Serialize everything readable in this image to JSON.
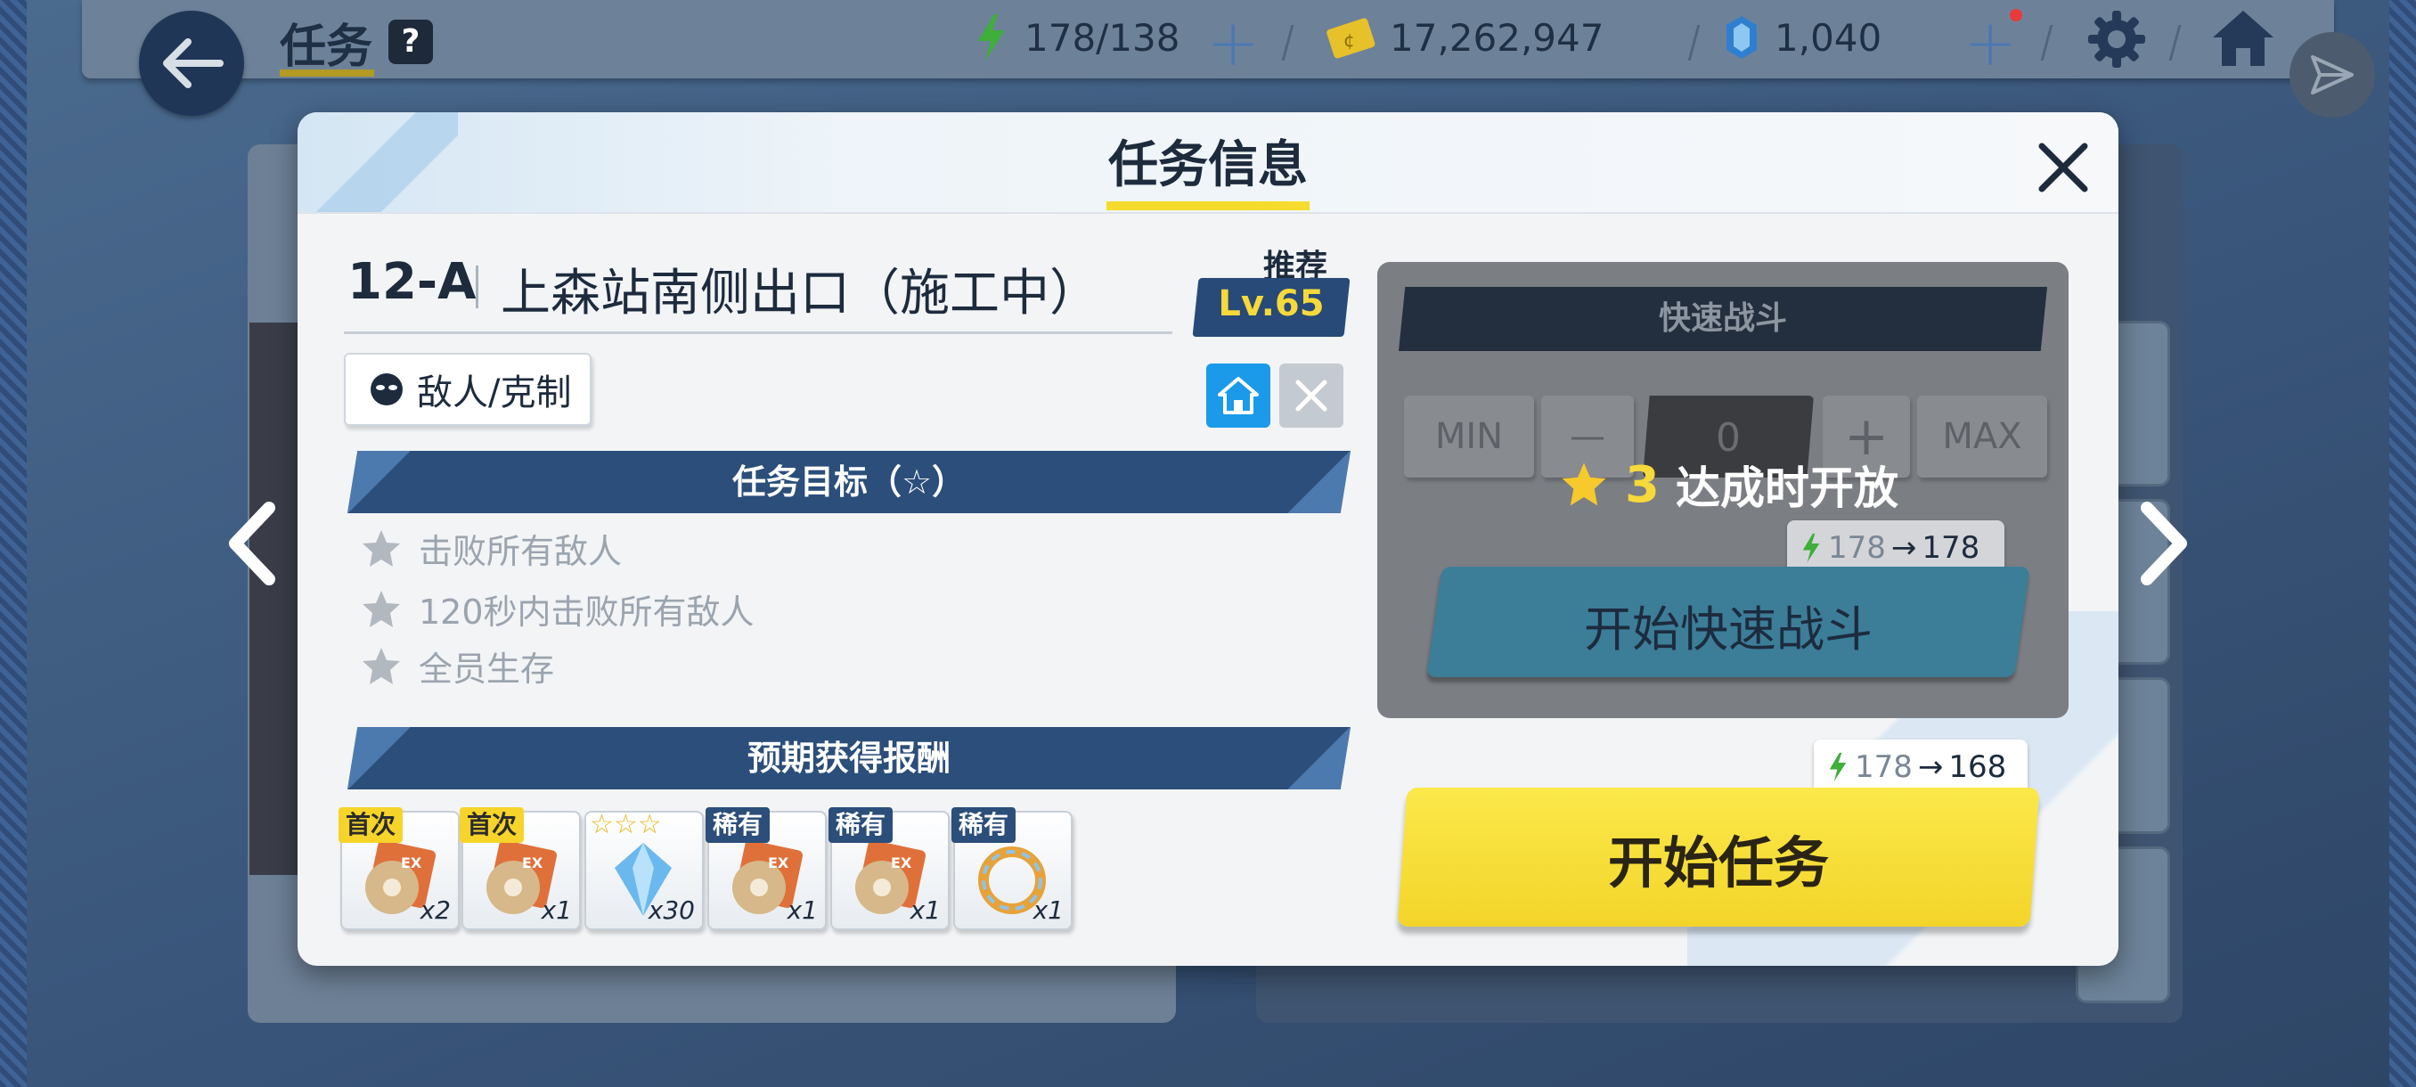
{
  "header": {
    "title": "任务",
    "help_label": "?",
    "stamina": "178/138",
    "credits": "17,262,947",
    "gems": "1,040"
  },
  "modal": {
    "title": "任务信息",
    "stage_code": "12-A",
    "stage_name": "上森站南侧出口（施工中）",
    "recommend_label": "推荐",
    "recommend_level": "Lv.65",
    "enemy_button": "敌人/克制",
    "objectives_header": "任务目标（☆）",
    "objectives": [
      "击败所有敌人",
      "120秒内击败所有敌人",
      "全员生存"
    ],
    "rewards_header": "预期获得报酬",
    "rewards": [
      {
        "tag": "首次",
        "qty": "x2",
        "icon": "ex-disc-icon"
      },
      {
        "tag": "首次",
        "qty": "x1",
        "icon": "ex-disc-icon"
      },
      {
        "tag": "☆☆☆",
        "qty": "x30",
        "icon": "blue-crystal-icon"
      },
      {
        "tag": "稀有",
        "qty": "x1",
        "icon": "ex-disc-icon"
      },
      {
        "tag": "稀有",
        "qty": "x1",
        "icon": "ex-disc-icon"
      },
      {
        "tag": "稀有",
        "qty": "x1",
        "icon": "ring-part-icon"
      }
    ],
    "sweep": {
      "header": "快速战斗",
      "min_label": "MIN",
      "minus_label": "—",
      "count": "0",
      "plus_label": "+",
      "max_label": "MAX",
      "unlock_stars": "3",
      "unlock_text": "达成时开放",
      "cost_from": "178",
      "cost_to": "178",
      "button": "开始快速战斗"
    },
    "start": {
      "cost_from": "178",
      "cost_to": "168",
      "button": "开始任务"
    }
  },
  "colors": {
    "accent_yellow": "#f5dc2c",
    "navy": "#2b4e7a",
    "stamina_green": "#3fae3a"
  }
}
